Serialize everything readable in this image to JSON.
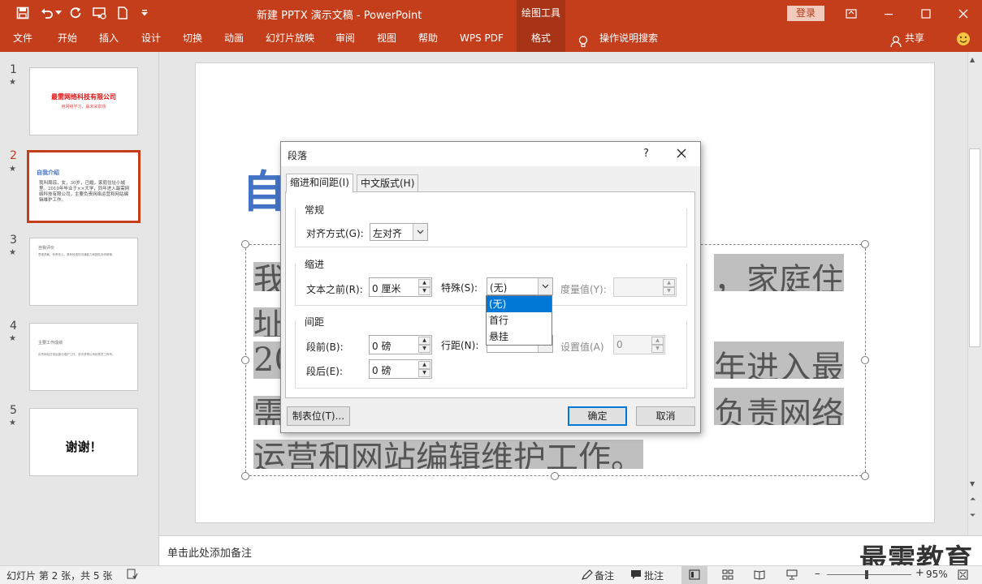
{
  "titlebar": {
    "title": "新建 PPTX 演示文稿  -  PowerPoint",
    "context_tools": "绘图工具",
    "login": "登录"
  },
  "ribbon": {
    "tabs": [
      "文件",
      "开始",
      "插入",
      "设计",
      "切换",
      "动画",
      "幻灯片放映",
      "审阅",
      "视图",
      "帮助",
      "WPS PDF"
    ],
    "active_tab": "格式",
    "search_hint": "操作说明搜索",
    "share": "共享"
  },
  "thumbnails": [
    {
      "num": "1",
      "star": "★",
      "title": "最需网络科技有限公司",
      "subtitle": "用网络学习，赢未来职场"
    },
    {
      "num": "2",
      "star": "★",
      "title": "自我介绍",
      "body": "我叫周琼，女，30岁，已婚，家庭住址小城里。2010年毕业于××大学，同年进入最需网络科技有限公司，主要负责网络运营和网站编辑维护工作。"
    },
    {
      "num": "3",
      "star": "★",
      "title": "自我评价",
      "body": "思维灵敏、有责任心，具有较强的沟通能力和团队协作精神。"
    },
    {
      "num": "4",
      "star": "★",
      "title": "主要工作成绩",
      "body": "负责网站日常运营与维护工作，多次获得公司优秀员工称号。"
    },
    {
      "num": "5",
      "star": "★",
      "title": "谢谢！"
    }
  ],
  "slide": {
    "title_char": "自",
    "body_lines": [
      {
        "left": "我",
        "right": "，家庭住"
      },
      {
        "left": "址"
      },
      {
        "left": "20",
        "right": "年进入最"
      },
      {
        "left": "需",
        "right": "负责网络"
      },
      {
        "left": "运营和网站编辑维护工作。"
      }
    ]
  },
  "notes": {
    "placeholder": "单击此处添加备注"
  },
  "watermark": "最需教育",
  "statusbar": {
    "slide_info": "幻灯片 第 2 张，共 5 张",
    "notes_btn": "备注",
    "comments_btn": "批注",
    "zoom": "95%",
    "zoom_percent": 95
  },
  "dialog": {
    "title": "段落",
    "help": "?",
    "tabs": [
      "缩进和间距(I)",
      "中文版式(H)"
    ],
    "general": {
      "heading": "常规",
      "align_label": "对齐方式(G):",
      "align_value": "左对齐"
    },
    "indent": {
      "heading": "缩进",
      "before_label": "文本之前(R):",
      "before_value": "0 厘米",
      "special_label": "特殊(S):",
      "special_value": "(无)",
      "measure_label": "度量值(Y):",
      "special_options": [
        "(无)",
        "首行",
        "悬挂"
      ]
    },
    "spacing": {
      "heading": "间距",
      "before_label": "段前(B):",
      "before_value": "0 磅",
      "after_label": "段后(E):",
      "after_value": "0 磅",
      "line_label": "行距(N):",
      "setting_label": "设置值(A)",
      "setting_value": "0"
    },
    "buttons": {
      "tabs": "制表位(T)...",
      "ok": "确定",
      "cancel": "取消"
    }
  }
}
